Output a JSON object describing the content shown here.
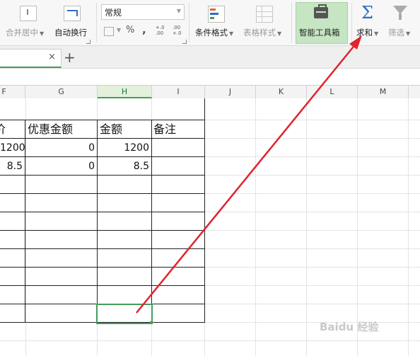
{
  "ribbon": {
    "merge_center": "合并居中",
    "auto_wrap": "自动换行",
    "number_format": "常规",
    "percent": "%",
    "comma": ",",
    "dec_increase": "+.0 .00",
    "dec_decrease": ".00 +.0",
    "conditional_format": "条件格式",
    "table_style": "表格样式",
    "smart_toolbox": "智能工具箱",
    "sum": "求和",
    "filter": "筛选"
  },
  "tabs": {
    "close": "×",
    "add": "+"
  },
  "columns": [
    "F",
    "G",
    "H",
    "I",
    "J",
    "K",
    "L",
    "M"
  ],
  "selected_column": "H",
  "table": {
    "headers": [
      "价",
      "优惠金额",
      "金额",
      "备注"
    ],
    "rows": [
      [
        "1200",
        "0",
        "1200",
        ""
      ],
      [
        "8.5",
        "0",
        "8.5",
        ""
      ]
    ]
  },
  "watermark": "Baidu 经验",
  "colors": {
    "accent_green": "#41a05a",
    "arrow_red": "#e0232e",
    "sigma_blue": "#2f6fc4"
  }
}
